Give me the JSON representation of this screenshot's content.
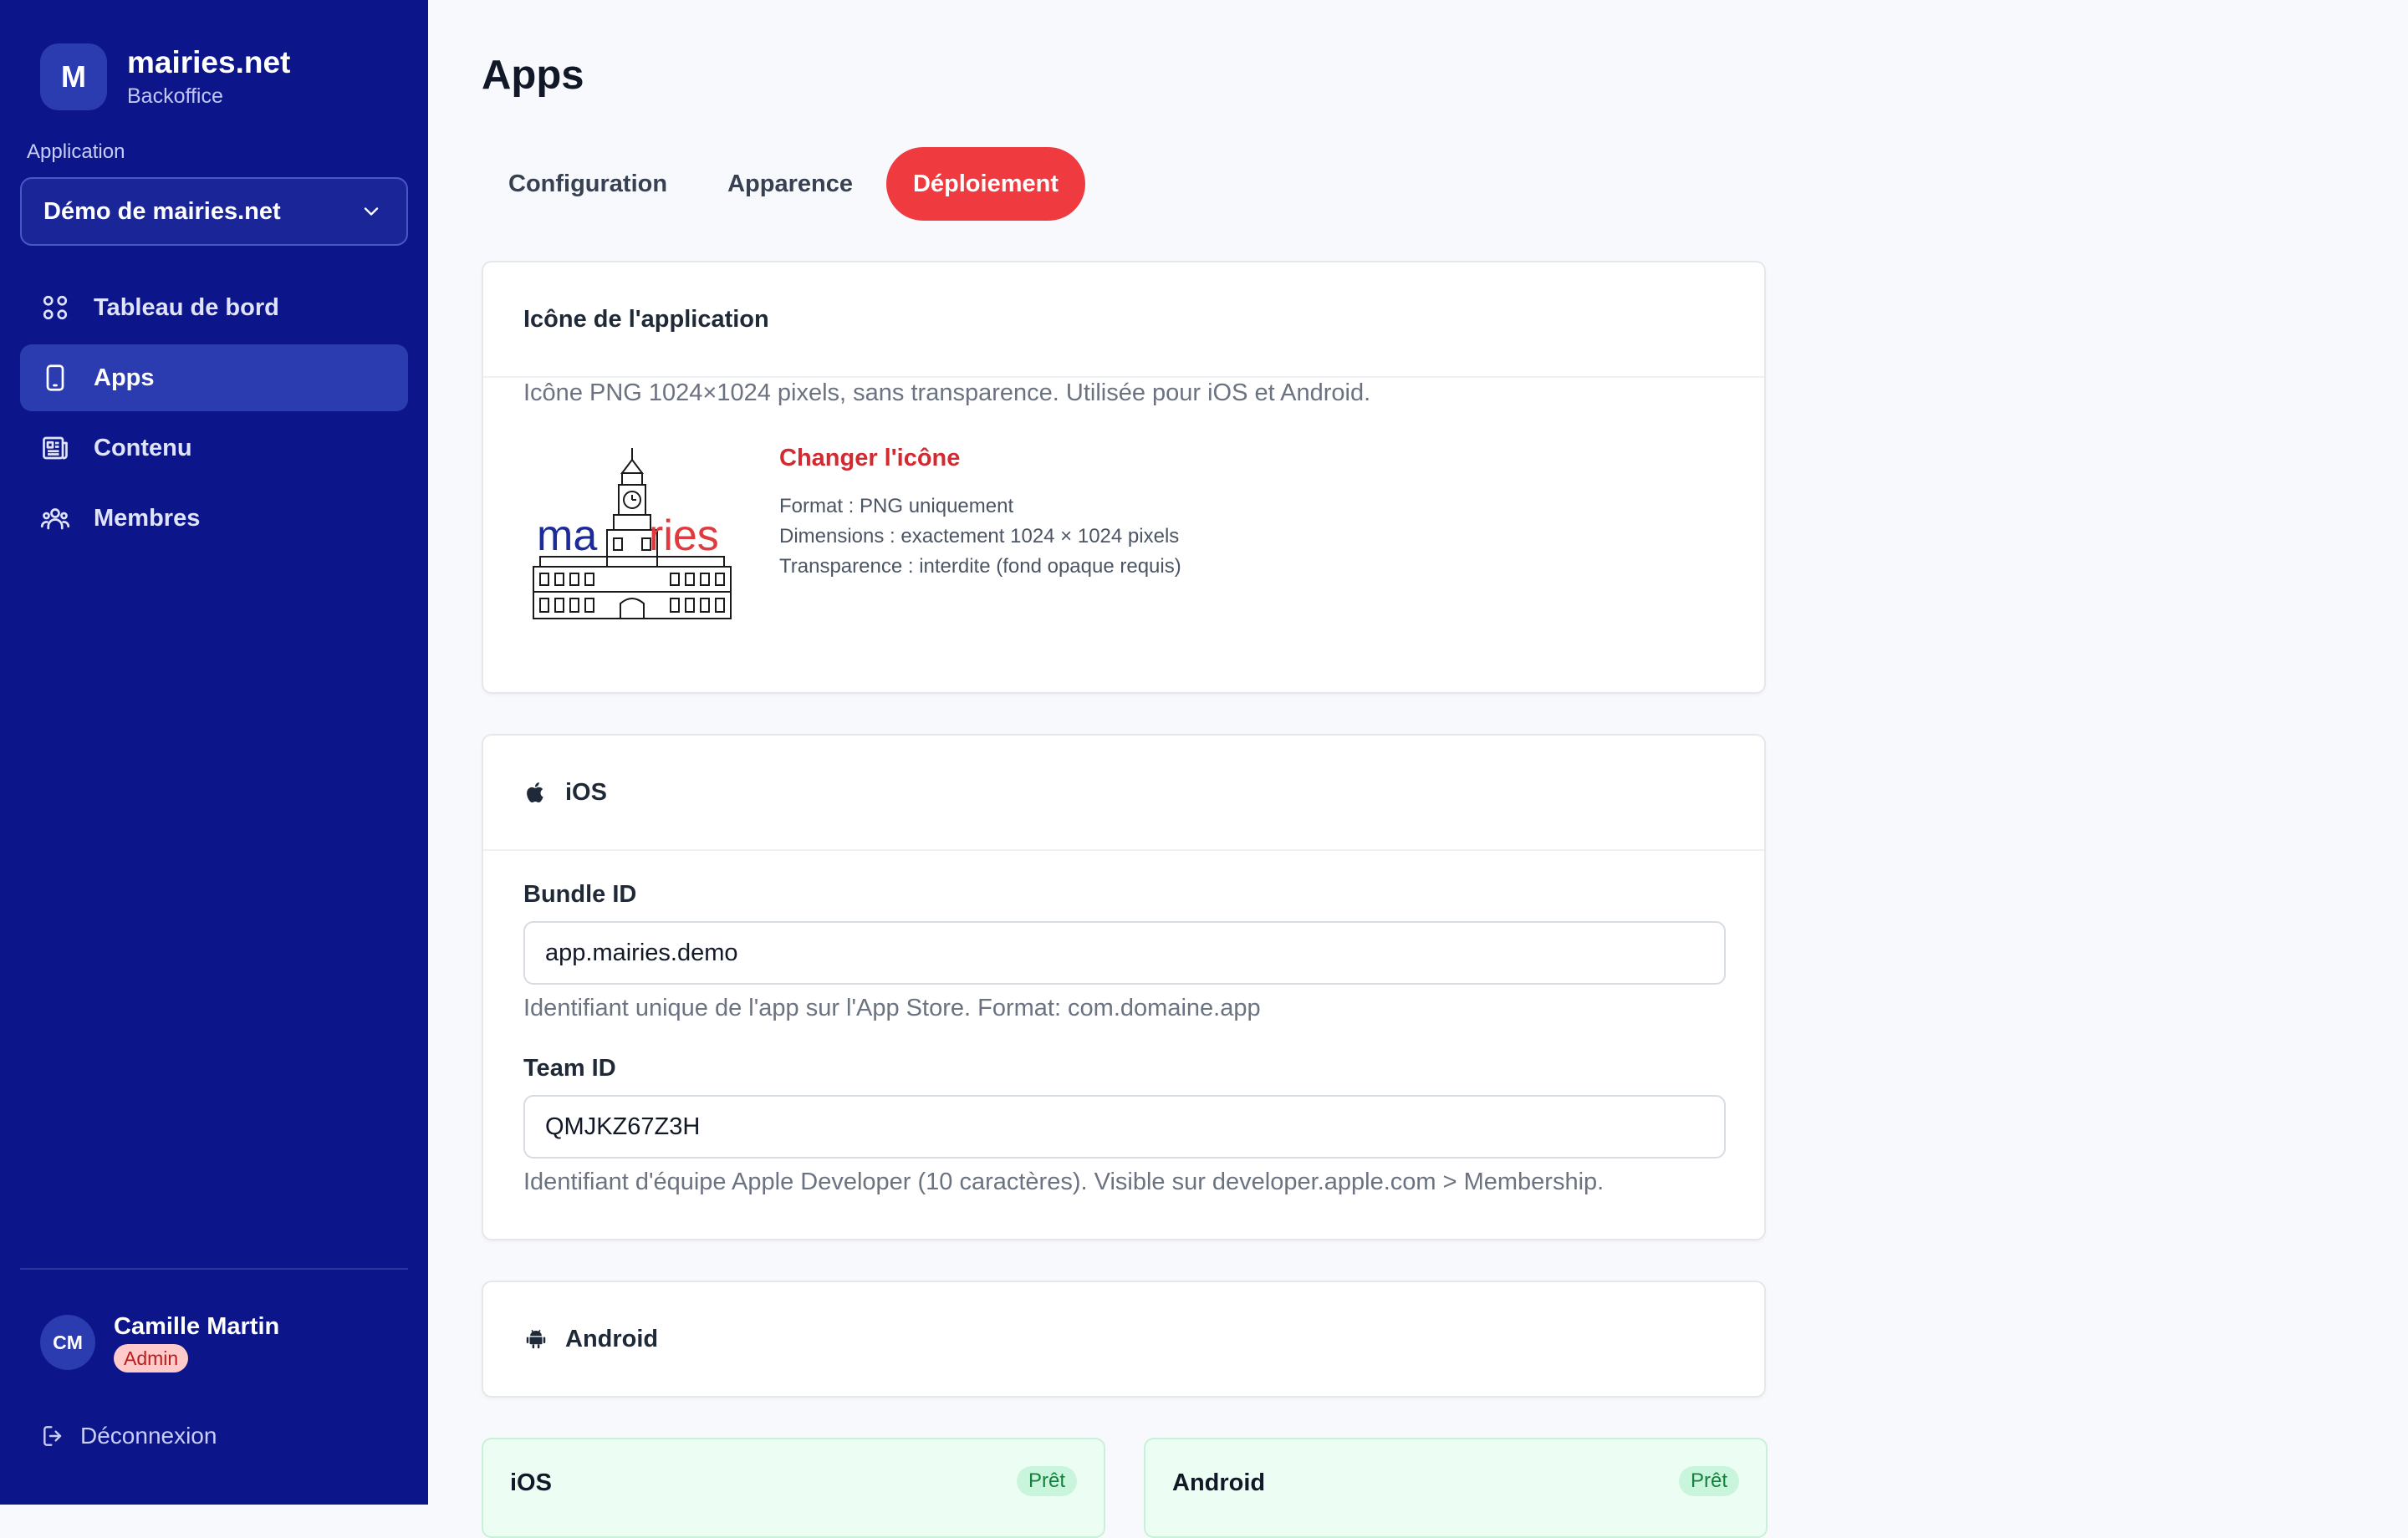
{
  "brand": {
    "logo_letter": "M",
    "name": "mairies.net",
    "subtitle": "Backoffice"
  },
  "app_selector": {
    "label": "Application",
    "value": "Démo de mairies.net"
  },
  "nav": {
    "items": [
      {
        "label": "Tableau de bord",
        "icon": "grid-icon",
        "active": false
      },
      {
        "label": "Apps",
        "icon": "smartphone-icon",
        "active": true
      },
      {
        "label": "Contenu",
        "icon": "newspaper-icon",
        "active": false
      },
      {
        "label": "Membres",
        "icon": "users-icon",
        "active": false
      }
    ]
  },
  "user": {
    "initials": "CM",
    "name": "Camille Martin",
    "role": "Admin"
  },
  "logout_label": "Déconnexion",
  "page": {
    "title": "Apps"
  },
  "tabs": [
    {
      "label": "Configuration",
      "active": false
    },
    {
      "label": "Apparence",
      "active": false
    },
    {
      "label": "Déploiement",
      "active": true
    }
  ],
  "icon_card": {
    "title": "Icône de l'application",
    "description": "Icône PNG 1024×1024 pixels, sans transparence. Utilisée pour iOS et Android.",
    "change_link": "Changer l'icône",
    "specs": [
      "Format : PNG uniquement",
      "Dimensions : exactement 1024 × 1024 pixels",
      "Transparence : interdite (fond opaque requis)"
    ],
    "logo_text_left": "ma",
    "logo_text_right": "ries"
  },
  "ios_card": {
    "title": "iOS",
    "bundle_label": "Bundle ID",
    "bundle_value": "app.mairies.demo",
    "bundle_help": "Identifiant unique de l'app sur l'App Store. Format: com.domaine.app",
    "team_label": "Team ID",
    "team_value": "QMJKZ67Z3H",
    "team_help": "Identifiant d'équipe Apple Developer (10 caractères). Visible sur developer.apple.com > Membership."
  },
  "android_card": {
    "title": "Android"
  },
  "status_cards": [
    {
      "platform": "iOS",
      "status": "Prêt"
    },
    {
      "platform": "Android",
      "status": "Prêt"
    }
  ],
  "colors": {
    "sidebar": "#0c168a",
    "accent": "#ef3b3f",
    "link": "#d22a30",
    "ready_bg": "#ecfdf3",
    "ready_text": "#15803d"
  }
}
